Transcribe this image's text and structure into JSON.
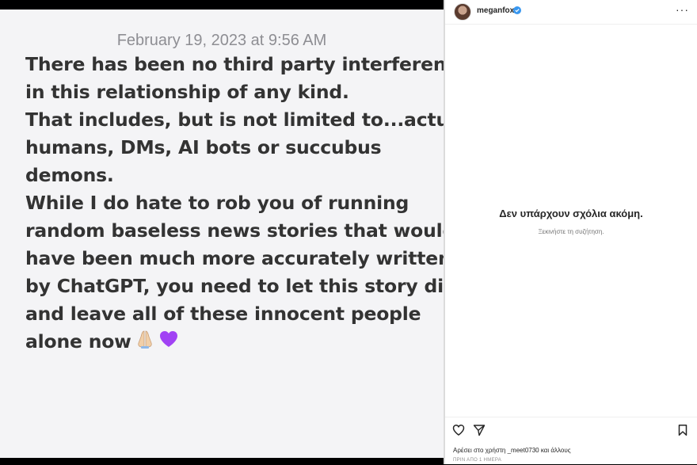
{
  "note": {
    "date": "February 19, 2023 at 9:56 AM",
    "lines": [
      "There has been no third party interference",
      "in this relationship of any kind.",
      "That includes, but is not limited to...actual",
      "humans, DMs, AI bots or succubus",
      "demons.",
      "While I do hate to rob you of running",
      "random baseless news stories that would",
      "have been much more accurately written",
      "by ChatGPT, you need to let this story die",
      "and leave all of these innocent people",
      "alone now"
    ],
    "emojis": [
      "praying-hands-icon",
      "purple-heart-icon"
    ]
  },
  "post": {
    "username": "meganfox",
    "verified": true,
    "empty_title": "Δεν υπάρχουν σχόλια ακόμη.",
    "empty_subtitle": "Ξεκινήστε τη συζήτηση.",
    "likes_text": "Αρέσει στο χρήστη _meet0730 και άλλους",
    "time_text": "ΠΡΙΝ ΑΠΟ 1 ΗΜΕΡΑ"
  },
  "colors": {
    "note_bg": "#f4f4f6",
    "note_text": "#333333",
    "date_text": "#8e8e93",
    "verified_blue": "#3897f0",
    "purple_heart": "#a142f4"
  }
}
